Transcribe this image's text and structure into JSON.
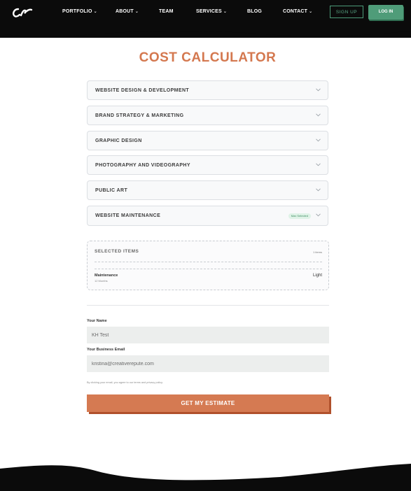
{
  "header": {
    "logo_text": "cr",
    "nav": [
      {
        "label": "PORTFOLIO",
        "has_dropdown": true
      },
      {
        "label": "ABOUT",
        "has_dropdown": true
      },
      {
        "label": "TEAM",
        "has_dropdown": false
      },
      {
        "label": "SERVICES",
        "has_dropdown": true
      },
      {
        "label": "BLOG",
        "has_dropdown": false
      },
      {
        "label": "CONTACT",
        "has_dropdown": true
      }
    ],
    "signup_label": "SIGN UP",
    "login_label": "LOG IN"
  },
  "main": {
    "title": "COST CALCULATOR",
    "accordion": [
      {
        "label": "WEBSITE DESIGN & DEVELOPMENT"
      },
      {
        "label": "BRAND STRATEGY & MARKETING"
      },
      {
        "label": "GRAPHIC DESIGN"
      },
      {
        "label": "PHOTOGRAPHY AND VIDEOGRAPHY"
      },
      {
        "label": "PUBLIC ART"
      },
      {
        "label": "WEBSITE MAINTENANCE",
        "badge": "Max Selected"
      }
    ],
    "selected": {
      "title": "SELECTED ITEMS",
      "count": "1 items",
      "items": [
        {
          "name": "Maintenance",
          "sub": "12 Months",
          "value": "Light"
        }
      ]
    },
    "form": {
      "name_label": "Your Name",
      "name_value": "KH Test",
      "email_label": "Your Business Email",
      "email_value": "kristina@creativerepute.com",
      "disclaimer": "By clicking your email, you agree to our terms and privacy policy.",
      "submit_label": "GET MY ESTIMATE"
    }
  },
  "colors": {
    "header_bg": "#0b0b0b",
    "accent_orange": "#d57a52",
    "accent_green": "#4f9c79"
  }
}
